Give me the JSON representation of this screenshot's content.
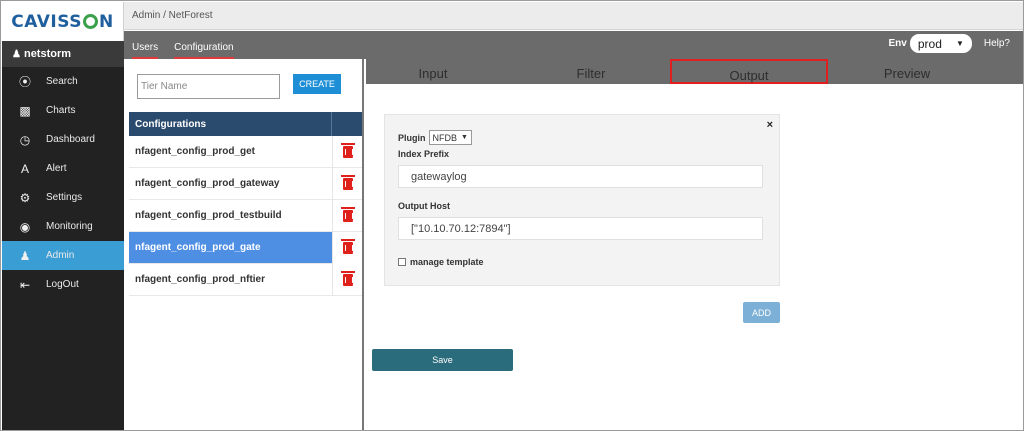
{
  "sidebar": {
    "logo_left": "CAVISS",
    "logo_right": "N",
    "brand": "netstorm",
    "items": [
      {
        "label": "Search",
        "icon": "compass-icon"
      },
      {
        "label": "Charts",
        "icon": "bar-chart-icon"
      },
      {
        "label": "Dashboard",
        "icon": "gauge-icon"
      },
      {
        "label": "Alert",
        "icon": "alert-icon"
      },
      {
        "label": "Settings",
        "icon": "gear-icon"
      },
      {
        "label": "Monitoring",
        "icon": "globe-icon"
      },
      {
        "label": "Admin",
        "icon": "user-icon"
      },
      {
        "label": "LogOut",
        "icon": "logout-icon"
      }
    ],
    "active_item": "Admin",
    "active_color": "#3a9dd4"
  },
  "breadcrumb": "Admin / NetForest",
  "subnav": {
    "tabs": [
      "Users",
      "Configuration"
    ],
    "env_label": "Env",
    "env_value": "prod",
    "help": "Help?"
  },
  "left": {
    "tier_placeholder": "Tier Name",
    "create_label": "CREATE",
    "configs_header": "Configurations",
    "configs": [
      "nfagent_config_prod_get",
      "nfagent_config_prod_gateway",
      "nfagent_config_prod_testbuild",
      "nfagent_config_prod_gate",
      "nfagent_config_prod_nftier"
    ],
    "selected": "nfagent_config_prod_gate"
  },
  "tabs": {
    "items": [
      "Input",
      "Filter",
      "Output",
      "Preview"
    ],
    "active": "Output"
  },
  "output_form": {
    "close": "×",
    "plugin_label": "Plugin",
    "plugin_value": "NFDB",
    "index_prefix_label": "Index Prefix",
    "index_prefix_value": "gatewaylog",
    "output_host_label": "Output Host",
    "output_host_value": "[\"10.10.70.12:7894\"]",
    "manage_template_label": "manage template",
    "add_label": "ADD",
    "save_label": "Save"
  }
}
